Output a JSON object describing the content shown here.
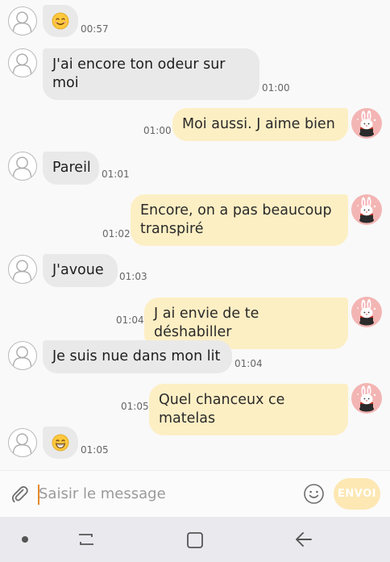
{
  "messages": [
    {
      "direction": "in",
      "emoji": "smiling-face-with-smiling-eyes",
      "time": "00:57"
    },
    {
      "direction": "in",
      "text": "J'ai encore ton odeur sur moi",
      "lines": [
        "J'ai encore ton odeur sur",
        "moi"
      ],
      "time": "01:00"
    },
    {
      "direction": "out",
      "text": "Moi aussi. J aime bien",
      "time": "01:00"
    },
    {
      "direction": "in",
      "text": "Pareil",
      "time": "01:01"
    },
    {
      "direction": "out",
      "text": "Encore, on a pas beaucoup transpiré",
      "lines": [
        "Encore, on a pas beaucoup",
        "transpiré"
      ],
      "time": "01:02"
    },
    {
      "direction": "in",
      "text": "J'avoue",
      "time": "01:03"
    },
    {
      "direction": "out",
      "text": "J ai envie de te déshabiller",
      "time": "01:04"
    },
    {
      "direction": "in",
      "text": "Je suis nue dans mon lit",
      "time": "01:04"
    },
    {
      "direction": "out",
      "text": "Quel chanceux ce matelas",
      "time": "01:05"
    },
    {
      "direction": "in",
      "emoji": "grinning-face-with-smiling-eyes",
      "time": "01:05"
    }
  ],
  "composer": {
    "placeholder": "Saisir le message",
    "value": "",
    "send_label": "ENVOI"
  },
  "icons": {
    "attach": "paperclip-icon",
    "emoji": "smiley-icon",
    "contact_avatar": "person-silhouette-icon",
    "own_avatar": "bunny-in-hat-icon",
    "nav_dot": "dot-icon",
    "nav_recent": "recent-apps-icon",
    "nav_home": "home-icon",
    "nav_back": "back-arrow-icon"
  },
  "colors": {
    "incoming_bubble": "#e9e9e9",
    "outgoing_bubble": "#fdefc4",
    "send_button": "#fde7b3",
    "caret": "#e38a2c",
    "own_avatar_bg": "#f3b5b3",
    "navbar": "#e9e9ee"
  }
}
